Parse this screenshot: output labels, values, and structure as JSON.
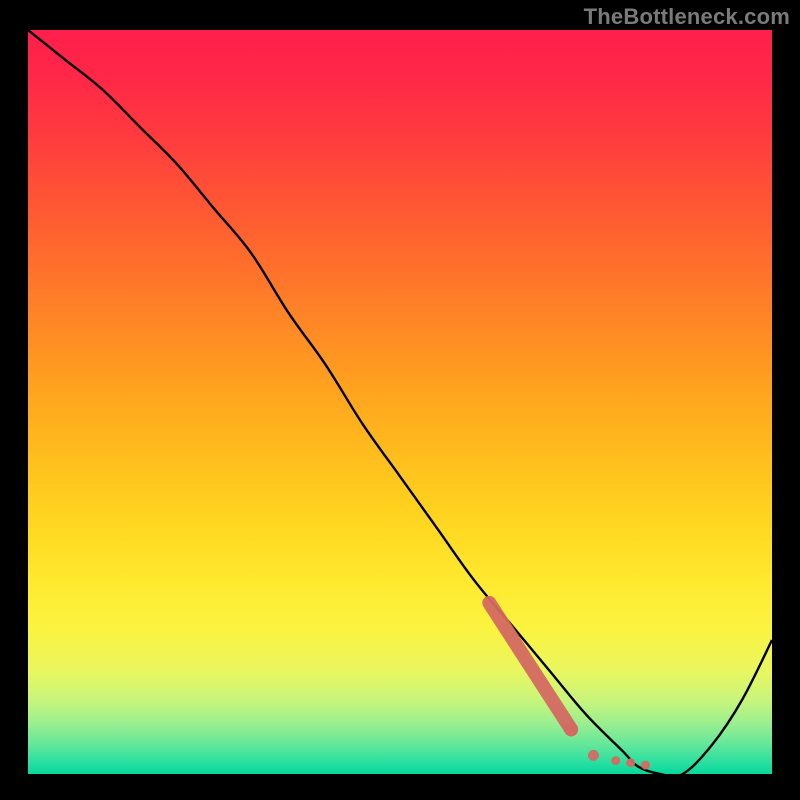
{
  "watermark": "TheBottleneck.com",
  "gradient": {
    "stops": [
      {
        "offset": 0.0,
        "color": "#ff1f4b"
      },
      {
        "offset": 0.06,
        "color": "#ff2748"
      },
      {
        "offset": 0.14,
        "color": "#ff3a3f"
      },
      {
        "offset": 0.22,
        "color": "#ff5235"
      },
      {
        "offset": 0.3,
        "color": "#ff6a2d"
      },
      {
        "offset": 0.38,
        "color": "#ff8327"
      },
      {
        "offset": 0.46,
        "color": "#ff9c20"
      },
      {
        "offset": 0.54,
        "color": "#ffb41d"
      },
      {
        "offset": 0.62,
        "color": "#ffcb1e"
      },
      {
        "offset": 0.68,
        "color": "#ffdb23"
      },
      {
        "offset": 0.74,
        "color": "#ffe92f"
      },
      {
        "offset": 0.8,
        "color": "#fcf33f"
      },
      {
        "offset": 0.86,
        "color": "#eaf65e"
      },
      {
        "offset": 0.9,
        "color": "#c9f57b"
      },
      {
        "offset": 0.93,
        "color": "#9eef8e"
      },
      {
        "offset": 0.96,
        "color": "#64e79a"
      },
      {
        "offset": 0.985,
        "color": "#28dfa0"
      },
      {
        "offset": 1.0,
        "color": "#05d79b"
      }
    ]
  },
  "chart_data": {
    "type": "line",
    "title": "",
    "xlabel": "",
    "ylabel": "",
    "xlim": [
      0,
      100
    ],
    "ylim": [
      0,
      100
    ],
    "series": [
      {
        "name": "bottleneck-curve",
        "x": [
          0,
          5,
          10,
          15,
          20,
          25,
          30,
          35,
          40,
          45,
          50,
          55,
          60,
          65,
          70,
          75,
          80,
          82,
          85,
          88,
          92,
          96,
          100
        ],
        "y": [
          100,
          96,
          92,
          87,
          82,
          76,
          70,
          62,
          55,
          47,
          40,
          33,
          26,
          20,
          14,
          8,
          3,
          1,
          0,
          0,
          4,
          10,
          18
        ]
      }
    ],
    "highlight_segment": {
      "name": "dotted-red-overlay",
      "color": "#d46a62",
      "points": [
        {
          "x": 62,
          "y": 23
        },
        {
          "x": 73,
          "y": 6
        },
        {
          "x": 76,
          "y": 2.5
        },
        {
          "x": 79,
          "y": 1.8
        },
        {
          "x": 81,
          "y": 1.5
        },
        {
          "x": 83,
          "y": 1.2
        }
      ]
    }
  }
}
